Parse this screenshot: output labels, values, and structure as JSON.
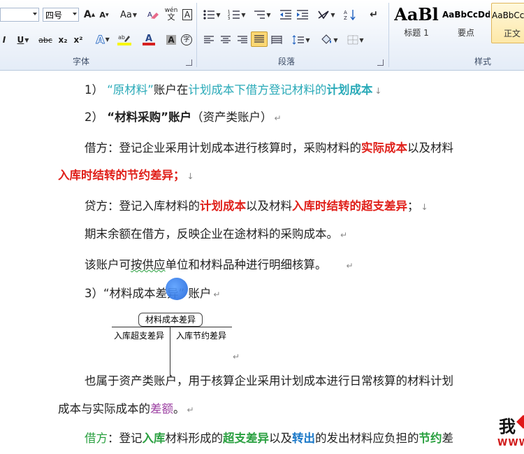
{
  "ribbon": {
    "font": {
      "size_value": "四号",
      "grow_icon": "A",
      "shrink_icon": "A",
      "change_case": "Aa",
      "phonetic_icon": "wén",
      "border_char": "A",
      "underline": "U",
      "strike": "abc",
      "subscript": "x₂",
      "superscript": "x²",
      "shading_char": "A",
      "enclose_char": "字",
      "group_label": "字体"
    },
    "paragraph": {
      "group_label": "段落"
    },
    "styles": {
      "group_label": "样式",
      "items": [
        {
          "preview": "AaBl",
          "name": "标题 1"
        },
        {
          "preview": "AaBbCcDd",
          "name": "要点"
        },
        {
          "preview": "AaBbCcDd",
          "name": "正文"
        }
      ]
    }
  },
  "doc": {
    "l1": {
      "num": "1）",
      "q": "“原材料”",
      "t1": "账户在",
      "t2": "计划成本下借方登记材料的",
      "t3": "计划成本"
    },
    "l2": {
      "num": "2）",
      "t1": "“材料采购”账户",
      "t2": "（资产类账户）"
    },
    "l3": {
      "t1": "借方：登记企业采用计划成本进行核算时，采购材料的",
      "t2": "实际成本",
      "t3": "以及材料"
    },
    "l4": {
      "t1": "入库时结转的节约差异；"
    },
    "l5": {
      "t1": "贷方：登记入库材料的",
      "t2": "计划成本",
      "t3": "以及材料",
      "t4": "入库时结转的超支差异",
      "t5": "；"
    },
    "l6": {
      "t1": "期末余额在借方，反映企业在途材料的采购成本。"
    },
    "l7": {
      "t1": "该账户可",
      "t2": "按供应",
      "t3": "单位和材料品种进行明细核算。"
    },
    "l8": {
      "t1": "3）“材料成本差异” 账户"
    },
    "taccount": {
      "title": "材料成本差异",
      "left": "入库超支差异",
      "right": "入库节约差异"
    },
    "l9": {
      "t1": "也属于资产类账户，用于核算企业采用计划成本进行日常核算的材料计划"
    },
    "l10": {
      "t1": "成本与实际成本的",
      "t2": "差额",
      "t3": "。"
    },
    "l11": {
      "t1": "借方",
      "t2": "：登记",
      "t3": "入库",
      "t4": "材料形成的",
      "t5": "超支差异",
      "t6": "以及",
      "t7": "转出",
      "t8": "的发出材料应负担的",
      "t9": "节约",
      "t10": "差"
    },
    "watermark": {
      "main": "我",
      "sub": "WWW"
    }
  },
  "colors": {
    "red": "#e0201a",
    "teal": "#2aaab8",
    "green": "#2aa040",
    "blue": "#1a78c8",
    "purple": "#9a3ca0"
  }
}
